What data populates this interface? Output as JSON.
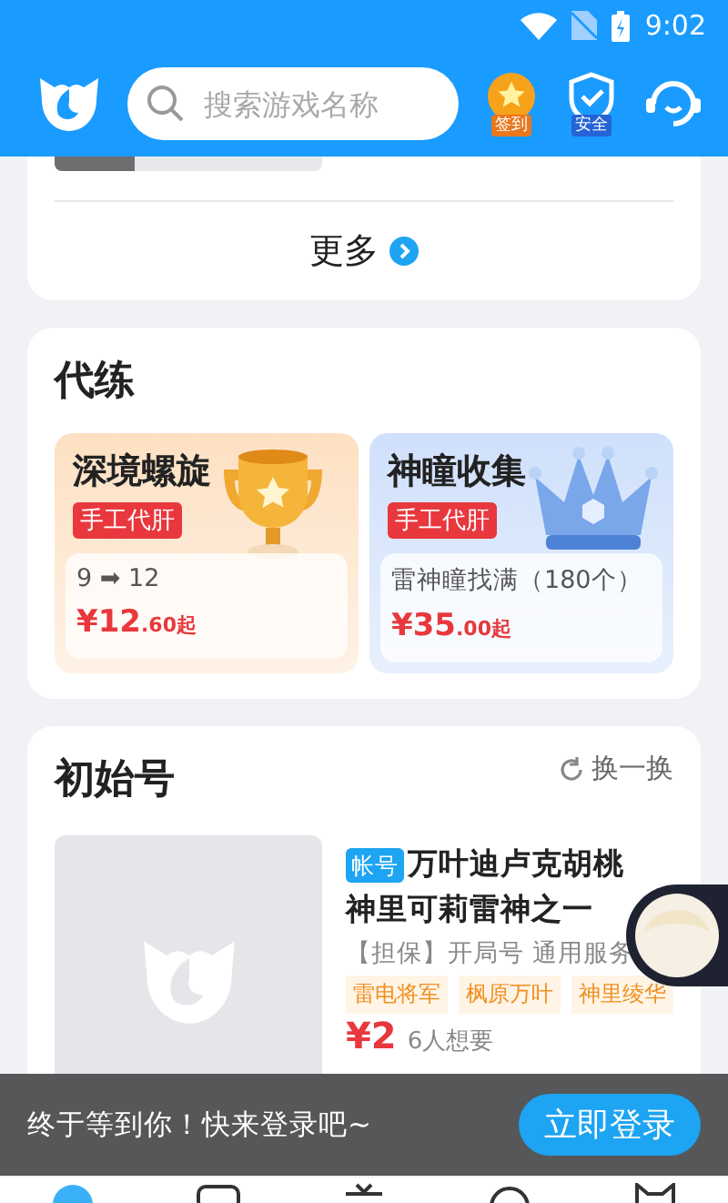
{
  "status_bar": {
    "time": "9:02"
  },
  "header": {
    "search": {
      "placeholder": "搜索游戏名称"
    },
    "badges": [
      {
        "kind": "checkin",
        "label": "签到"
      },
      {
        "kind": "security",
        "label": "安全"
      }
    ]
  },
  "top_card": {
    "more": "更多"
  },
  "boosting": {
    "title": "代练",
    "items": [
      {
        "kind": "trophy",
        "title": "深境螺旋",
        "tag": "手工代肝",
        "desc": "9 ➡ 12",
        "price": "¥12",
        "price_tail": ".60起"
      },
      {
        "kind": "crown",
        "title": "神瞳收集",
        "tag": "手工代肝",
        "desc": "雷神瞳找满（180个）",
        "price": "¥35",
        "price_tail": ".00起"
      }
    ]
  },
  "starter": {
    "title": "初始号",
    "refresh": "换一换",
    "item": {
      "badge": "帐号",
      "title": "万叶迪卢克胡桃神里可莉雷神之一",
      "desc": "【担保】开局号 通用服务",
      "tags": [
        "雷电将军",
        "枫原万叶",
        "神里绫华"
      ],
      "price": "¥2",
      "wants": "6人想要"
    }
  },
  "login_banner": {
    "text": "终于等到你！快来登录吧~",
    "button": "立即登录"
  }
}
